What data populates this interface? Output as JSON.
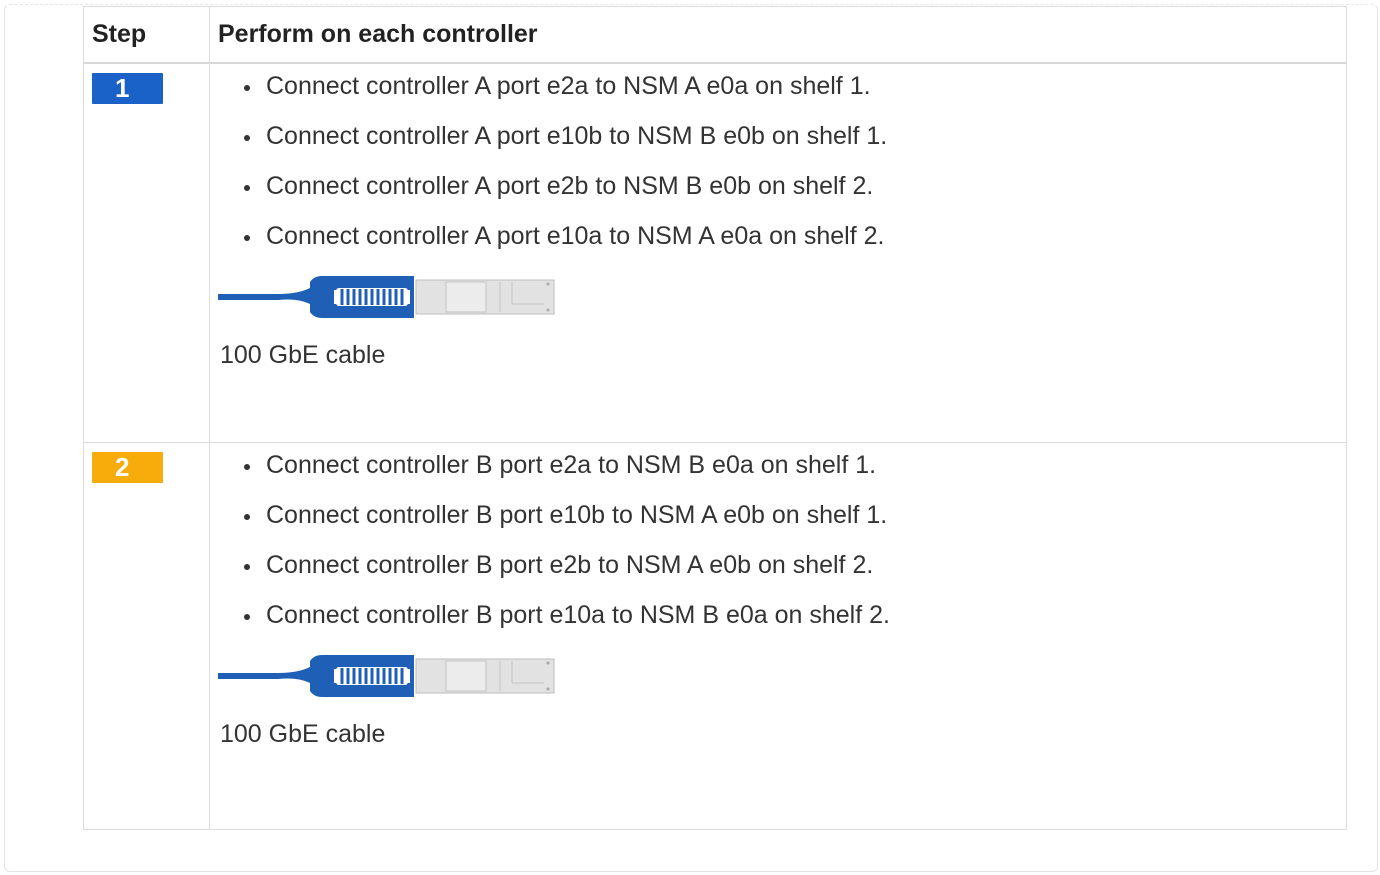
{
  "table": {
    "headers": {
      "step": "Step",
      "perform": "Perform on each controller"
    },
    "rows": [
      {
        "step_number": "1",
        "badge_color": "#1a62c8",
        "items": [
          "Connect controller A port e2a to NSM A e0a on shelf 1.",
          "Connect controller A port e10b to NSM B e0b on shelf 1.",
          "Connect controller A port e2b to NSM B e0b on shelf 2.",
          "Connect controller A port e10a to NSM A e0a on shelf 2."
        ],
        "caption": "100 GbE cable"
      },
      {
        "step_number": "2",
        "badge_color": "#f8ac0c",
        "items": [
          "Connect controller B port e2a to NSM B e0a on shelf 1.",
          "Connect controller B port e10b to NSM A e0b on shelf 1.",
          "Connect controller B port e2b to NSM A e0b on shelf 2.",
          "Connect controller B port e10a to NSM B e0a on shelf 2."
        ],
        "caption": "100 GbE cable"
      }
    ]
  },
  "icons": {
    "cable": "qsfp-cable-icon"
  },
  "colors": {
    "cable_blue": "#1f5fb5",
    "connector_grey": "#d9d9d9"
  }
}
